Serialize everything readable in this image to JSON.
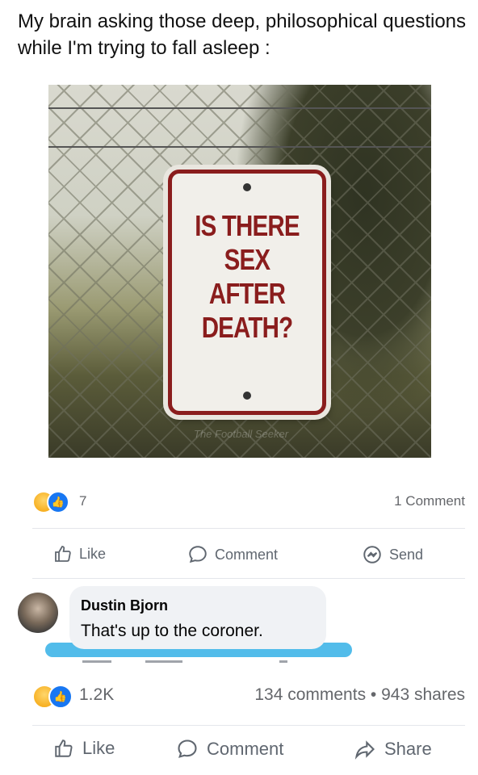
{
  "post": {
    "caption": "My brain asking those deep, philosophical questions while I'm trying to fall asleep :",
    "sign_lines": [
      "IS THERE",
      "SEX",
      "AFTER",
      "DEATH?"
    ],
    "watermark": "The Football Seeker"
  },
  "reactions": {
    "count": "7",
    "comments": "1 Comment",
    "icons": [
      "haha-icon",
      "like-icon"
    ]
  },
  "actions": {
    "like": "Like",
    "comment": "Comment",
    "send": "Send"
  },
  "comment": {
    "author": "Dustin Bjorn",
    "text": "That's up to the coroner."
  },
  "outer": {
    "reaction_count": "1.2K",
    "comments_shares": "134 comments • 943 shares",
    "like": "Like",
    "comment": "Comment",
    "share": "Share"
  },
  "colors": {
    "sign_red": "#8a1d1d",
    "facebook_blue": "#1877f2",
    "highlight": "#3fb5e8"
  }
}
